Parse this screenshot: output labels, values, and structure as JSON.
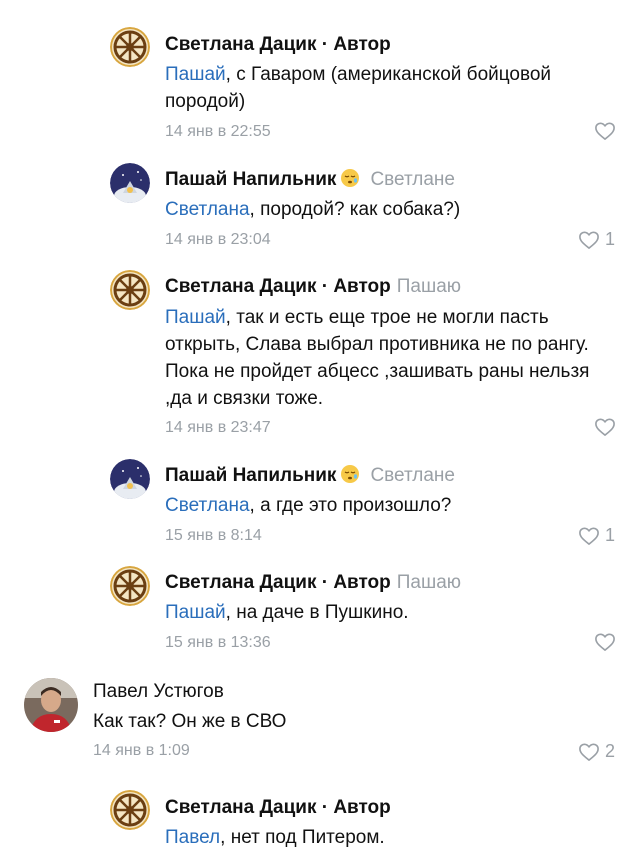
{
  "comments": [
    {
      "author": "Светлана Дацик · Автор",
      "reply_to": "",
      "mention": "Пашай",
      "text": ", с Гаваром (американской бойцовой породой)",
      "time": "14 янв в 22:55",
      "likes": ""
    },
    {
      "author": "Пашай Напильник",
      "reply_to": "Светлане",
      "mention": "Светлана",
      "text": ", породой? как собака?)",
      "time": "14 янв в 23:04",
      "likes": "1"
    },
    {
      "author": "Светлана Дацик · Автор",
      "reply_to": "Пашаю",
      "mention": "Пашай",
      "text": ", так и есть еще трое не могли пасть открыть, Слава выбрал противника не по рангу. Пока не пройдет абцесс ,зашивать раны нельзя ,да и связки тоже.",
      "time": "14 янв в 23:47",
      "likes": ""
    },
    {
      "author": "Пашай Напильник",
      "reply_to": "Светлане",
      "mention": "Светлана",
      "text": ", а где это произошло?",
      "time": "15 янв в 8:14",
      "likes": "1"
    },
    {
      "author": "Светлана Дацик · Автор",
      "reply_to": "Пашаю",
      "mention": "Пашай",
      "text": ", на даче в Пушкино.",
      "time": "15 янв в 13:36",
      "likes": ""
    },
    {
      "author": "Павел Устюгов",
      "reply_to": "",
      "mention": "",
      "text": "Как так? Он же в СВО",
      "time": "14 янв в 1:09",
      "likes": "2"
    },
    {
      "author": "Светлана Дацик · Автор",
      "reply_to": "",
      "mention": "Павел",
      "text": ", нет под Питером.",
      "time": "",
      "likes": ""
    }
  ],
  "colors": {
    "mention": "#2a6ebb",
    "meta": "#9aa0a6",
    "text": "#111111"
  },
  "icons": {
    "like": "heart-outline-icon",
    "author_emoji": "sleepy-face-emoji"
  }
}
